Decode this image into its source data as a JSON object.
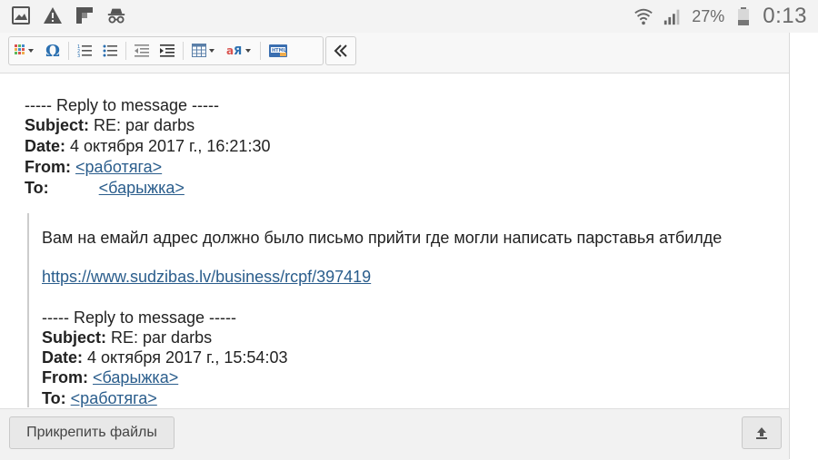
{
  "statusbar": {
    "battery_pct": "27%",
    "time": "0:13",
    "left_icons": [
      "gallery-notification-icon",
      "warning-icon",
      "flipboard-icon",
      "incognito-icon"
    ],
    "right_icons": [
      "wifi-icon",
      "signal-icon",
      "battery-icon"
    ]
  },
  "toolbar": {
    "buttons": [
      "apps-grid",
      "special-char-omega",
      "ordered-list",
      "unordered-list",
      "outdent",
      "indent",
      "table",
      "text-direction",
      "html-source"
    ],
    "collapse": "collapse-toolbar"
  },
  "message": {
    "reply_header": "----- Reply to message -----",
    "subject_label": "Subject:",
    "subject_value": "RE: par darbs",
    "date_label": "Date:",
    "date_value": "4 октября 2017 г., 16:21:30",
    "from_label": "From:",
    "from_value": "<работяга>",
    "to_label": "To:",
    "to_value": "<барыжка>",
    "quote": {
      "body": "Вам на емайл адрес должно было письмо прийти где могли написать парставья атбилде",
      "link": "https://www.sudzibas.lv/business/rcpf/397419",
      "reply_header": "----- Reply to message -----",
      "subject_label": "Subject:",
      "subject_value": "RE: par darbs",
      "date_label": "Date:",
      "date_value": "4 октября 2017 г., 15:54:03",
      "from_label": "From:",
      "from_value": "<барыжка>",
      "to_label": "To:",
      "to_value": "<работяга>"
    }
  },
  "bottombar": {
    "attach_label": "Прикрепить файлы"
  }
}
